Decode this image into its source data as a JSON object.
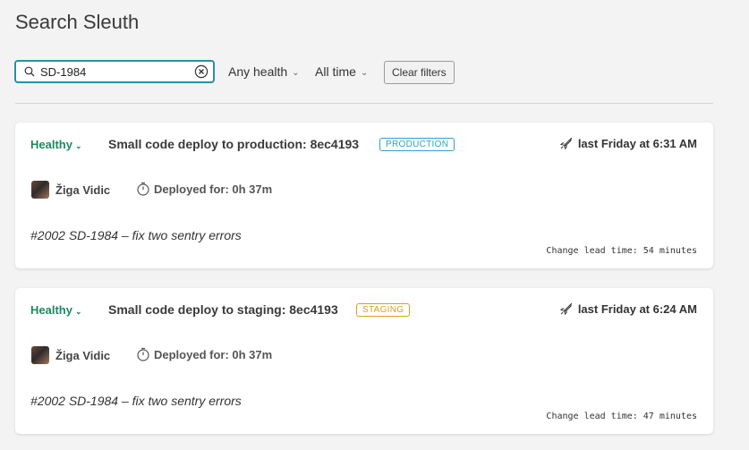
{
  "app": {
    "title": "Search Sleuth"
  },
  "filters": {
    "search_value": "SD-1984",
    "health": "Any health",
    "time": "All time",
    "clear_label": "Clear filters"
  },
  "deploys": [
    {
      "health": "Healthy",
      "title": "Small code deploy to production: 8ec4193",
      "environment": "PRODUCTION",
      "time": "last Friday at 6:31 AM",
      "author": "Žiga Vidic",
      "duration": "Deployed for: 0h 37m",
      "message": "#2002 SD-1984 – fix two sentry errors",
      "lead_time": "Change lead time: 54 minutes"
    },
    {
      "health": "Healthy",
      "title": "Small code deploy to staging: 8ec4193",
      "environment": "STAGING",
      "time": "last Friday at 6:24 AM",
      "author": "Žiga Vidic",
      "duration": "Deployed for: 0h 37m",
      "message": "#2002 SD-1984 – fix two sentry errors",
      "lead_time": "Change lead time: 47 minutes"
    }
  ],
  "colors": {
    "accent": "#2a8fa6",
    "healthy": "#1b8a5e",
    "production": "#2aa5bd",
    "staging": "#d9a11c"
  }
}
